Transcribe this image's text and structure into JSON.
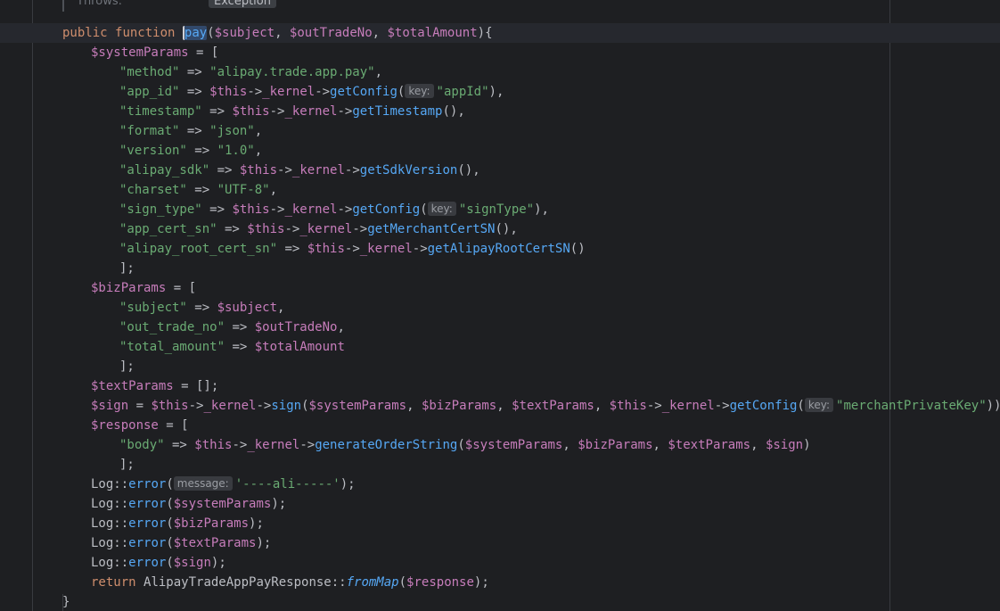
{
  "doc": {
    "throws_label": "Throws:",
    "throws_type": "Exception"
  },
  "lines": [
    {
      "indent": 0,
      "current": true,
      "tokens": [
        {
          "t": "public",
          "c": "kw"
        },
        {
          "t": " "
        },
        {
          "t": "function",
          "c": "kw"
        },
        {
          "t": " "
        },
        {
          "t": "pay",
          "c": "fn",
          "caret": true
        },
        {
          "t": "("
        },
        {
          "t": "$subject",
          "c": "var"
        },
        {
          "t": ", "
        },
        {
          "t": "$outTradeNo",
          "c": "var"
        },
        {
          "t": ", "
        },
        {
          "t": "$totalAmount",
          "c": "var"
        },
        {
          "t": "){"
        }
      ]
    },
    {
      "indent": 1,
      "tokens": [
        {
          "t": "$systemParams",
          "c": "var"
        },
        {
          "t": " = ["
        }
      ]
    },
    {
      "indent": 2,
      "tokens": [
        {
          "t": "\"method\"",
          "c": "str"
        },
        {
          "t": " => "
        },
        {
          "t": "\"alipay.trade.app.pay\"",
          "c": "str"
        },
        {
          "t": ","
        }
      ]
    },
    {
      "indent": 2,
      "tokens": [
        {
          "t": "\"app_id\"",
          "c": "str"
        },
        {
          "t": " => "
        },
        {
          "t": "$this",
          "c": "var"
        },
        {
          "t": "->"
        },
        {
          "t": "_kernel",
          "c": "var"
        },
        {
          "t": "->"
        },
        {
          "t": "getConfig",
          "c": "fn"
        },
        {
          "t": "("
        },
        {
          "t": "key:",
          "hint": true
        },
        {
          "t": "\"appId\"",
          "c": "str"
        },
        {
          "t": "),"
        }
      ]
    },
    {
      "indent": 2,
      "tokens": [
        {
          "t": "\"timestamp\"",
          "c": "str"
        },
        {
          "t": " => "
        },
        {
          "t": "$this",
          "c": "var"
        },
        {
          "t": "->"
        },
        {
          "t": "_kernel",
          "c": "var"
        },
        {
          "t": "->"
        },
        {
          "t": "getTimestamp",
          "c": "fn"
        },
        {
          "t": "(),"
        }
      ]
    },
    {
      "indent": 2,
      "tokens": [
        {
          "t": "\"format\"",
          "c": "str"
        },
        {
          "t": " => "
        },
        {
          "t": "\"json\"",
          "c": "str"
        },
        {
          "t": ","
        }
      ]
    },
    {
      "indent": 2,
      "tokens": [
        {
          "t": "\"version\"",
          "c": "str"
        },
        {
          "t": " => "
        },
        {
          "t": "\"1.0\"",
          "c": "str"
        },
        {
          "t": ","
        }
      ]
    },
    {
      "indent": 2,
      "tokens": [
        {
          "t": "\"alipay_sdk\"",
          "c": "str"
        },
        {
          "t": " => "
        },
        {
          "t": "$this",
          "c": "var"
        },
        {
          "t": "->"
        },
        {
          "t": "_kernel",
          "c": "var"
        },
        {
          "t": "->"
        },
        {
          "t": "getSdkVersion",
          "c": "fn"
        },
        {
          "t": "(),"
        }
      ]
    },
    {
      "indent": 2,
      "tokens": [
        {
          "t": "\"charset\"",
          "c": "str"
        },
        {
          "t": " => "
        },
        {
          "t": "\"UTF-8\"",
          "c": "str"
        },
        {
          "t": ","
        }
      ]
    },
    {
      "indent": 2,
      "tokens": [
        {
          "t": "\"sign_type\"",
          "c": "str"
        },
        {
          "t": " => "
        },
        {
          "t": "$this",
          "c": "var"
        },
        {
          "t": "->"
        },
        {
          "t": "_kernel",
          "c": "var"
        },
        {
          "t": "->"
        },
        {
          "t": "getConfig",
          "c": "fn"
        },
        {
          "t": "("
        },
        {
          "t": "key:",
          "hint": true
        },
        {
          "t": "\"signType\"",
          "c": "str"
        },
        {
          "t": "),"
        }
      ]
    },
    {
      "indent": 2,
      "tokens": [
        {
          "t": "\"app_cert_sn\"",
          "c": "str"
        },
        {
          "t": " => "
        },
        {
          "t": "$this",
          "c": "var"
        },
        {
          "t": "->"
        },
        {
          "t": "_kernel",
          "c": "var"
        },
        {
          "t": "->"
        },
        {
          "t": "getMerchantCertSN",
          "c": "fn"
        },
        {
          "t": "(),"
        }
      ]
    },
    {
      "indent": 2,
      "tokens": [
        {
          "t": "\"alipay_root_cert_sn\"",
          "c": "str"
        },
        {
          "t": " => "
        },
        {
          "t": "$this",
          "c": "var"
        },
        {
          "t": "->"
        },
        {
          "t": "_kernel",
          "c": "var"
        },
        {
          "t": "->"
        },
        {
          "t": "getAlipayRootCertSN",
          "c": "fn"
        },
        {
          "t": "()"
        }
      ]
    },
    {
      "indent": 2,
      "tokens": [
        {
          "t": "];"
        }
      ]
    },
    {
      "indent": 1,
      "tokens": [
        {
          "t": "$bizParams",
          "c": "var"
        },
        {
          "t": " = ["
        }
      ]
    },
    {
      "indent": 2,
      "tokens": [
        {
          "t": "\"subject\"",
          "c": "str"
        },
        {
          "t": " => "
        },
        {
          "t": "$subject",
          "c": "var"
        },
        {
          "t": ","
        }
      ]
    },
    {
      "indent": 2,
      "tokens": [
        {
          "t": "\"out_trade_no\"",
          "c": "str"
        },
        {
          "t": " => "
        },
        {
          "t": "$outTradeNo",
          "c": "var"
        },
        {
          "t": ","
        }
      ]
    },
    {
      "indent": 2,
      "tokens": [
        {
          "t": "\"total_amount\"",
          "c": "str"
        },
        {
          "t": " => "
        },
        {
          "t": "$totalAmount",
          "c": "var"
        }
      ]
    },
    {
      "indent": 2,
      "tokens": [
        {
          "t": "];"
        }
      ]
    },
    {
      "indent": 1,
      "tokens": [
        {
          "t": "$textParams",
          "c": "var"
        },
        {
          "t": " = [];"
        }
      ]
    },
    {
      "indent": 1,
      "tokens": [
        {
          "t": "$sign",
          "c": "var"
        },
        {
          "t": " = "
        },
        {
          "t": "$this",
          "c": "var"
        },
        {
          "t": "->"
        },
        {
          "t": "_kernel",
          "c": "var"
        },
        {
          "t": "->"
        },
        {
          "t": "sign",
          "c": "fn"
        },
        {
          "t": "("
        },
        {
          "t": "$systemParams",
          "c": "var"
        },
        {
          "t": ", "
        },
        {
          "t": "$bizParams",
          "c": "var"
        },
        {
          "t": ", "
        },
        {
          "t": "$textParams",
          "c": "var"
        },
        {
          "t": ", "
        },
        {
          "t": "$this",
          "c": "var"
        },
        {
          "t": "->"
        },
        {
          "t": "_kernel",
          "c": "var"
        },
        {
          "t": "->"
        },
        {
          "t": "getConfig",
          "c": "fn"
        },
        {
          "t": "("
        },
        {
          "t": "key:",
          "hint": true
        },
        {
          "t": "\"merchantPrivateKey\"",
          "c": "str"
        },
        {
          "t": "));"
        }
      ]
    },
    {
      "indent": 1,
      "tokens": [
        {
          "t": "$response",
          "c": "var"
        },
        {
          "t": " = ["
        }
      ]
    },
    {
      "indent": 2,
      "tokens": [
        {
          "t": "\"body\"",
          "c": "str"
        },
        {
          "t": " => "
        },
        {
          "t": "$this",
          "c": "var"
        },
        {
          "t": "->"
        },
        {
          "t": "_kernel",
          "c": "var"
        },
        {
          "t": "->"
        },
        {
          "t": "generateOrderString",
          "c": "fn"
        },
        {
          "t": "("
        },
        {
          "t": "$systemParams",
          "c": "var"
        },
        {
          "t": ", "
        },
        {
          "t": "$bizParams",
          "c": "var"
        },
        {
          "t": ", "
        },
        {
          "t": "$textParams",
          "c": "var"
        },
        {
          "t": ", "
        },
        {
          "t": "$sign",
          "c": "var"
        },
        {
          "t": ")"
        }
      ]
    },
    {
      "indent": 2,
      "tokens": [
        {
          "t": "];"
        }
      ]
    },
    {
      "indent": 1,
      "tokens": [
        {
          "t": "Log",
          "c": "cls"
        },
        {
          "t": "::"
        },
        {
          "t": "error",
          "c": "fn"
        },
        {
          "t": "("
        },
        {
          "t": "message:",
          "hint": true
        },
        {
          "t": "'----ali-----'",
          "c": "str"
        },
        {
          "t": ");"
        }
      ]
    },
    {
      "indent": 1,
      "tokens": [
        {
          "t": "Log",
          "c": "cls"
        },
        {
          "t": "::"
        },
        {
          "t": "error",
          "c": "fn"
        },
        {
          "t": "("
        },
        {
          "t": "$systemParams",
          "c": "var"
        },
        {
          "t": ");"
        }
      ]
    },
    {
      "indent": 1,
      "tokens": [
        {
          "t": "Log",
          "c": "cls"
        },
        {
          "t": "::"
        },
        {
          "t": "error",
          "c": "fn"
        },
        {
          "t": "("
        },
        {
          "t": "$bizParams",
          "c": "var"
        },
        {
          "t": ");"
        }
      ]
    },
    {
      "indent": 1,
      "tokens": [
        {
          "t": "Log",
          "c": "cls"
        },
        {
          "t": "::"
        },
        {
          "t": "error",
          "c": "fn"
        },
        {
          "t": "("
        },
        {
          "t": "$textParams",
          "c": "var"
        },
        {
          "t": ");"
        }
      ]
    },
    {
      "indent": 1,
      "tokens": [
        {
          "t": "Log",
          "c": "cls"
        },
        {
          "t": "::"
        },
        {
          "t": "error",
          "c": "fn"
        },
        {
          "t": "("
        },
        {
          "t": "$sign",
          "c": "var"
        },
        {
          "t": ");"
        }
      ]
    },
    {
      "indent": 1,
      "tokens": [
        {
          "t": "return",
          "c": "kw"
        },
        {
          "t": " "
        },
        {
          "t": "AlipayTradeAppPayResponse",
          "c": "cls"
        },
        {
          "t": "::"
        },
        {
          "t": "fromMap",
          "c": "it"
        },
        {
          "t": "("
        },
        {
          "t": "$response",
          "c": "var"
        },
        {
          "t": ");"
        }
      ]
    },
    {
      "indent": 0,
      "tokens": [
        {
          "t": "}"
        }
      ]
    }
  ]
}
